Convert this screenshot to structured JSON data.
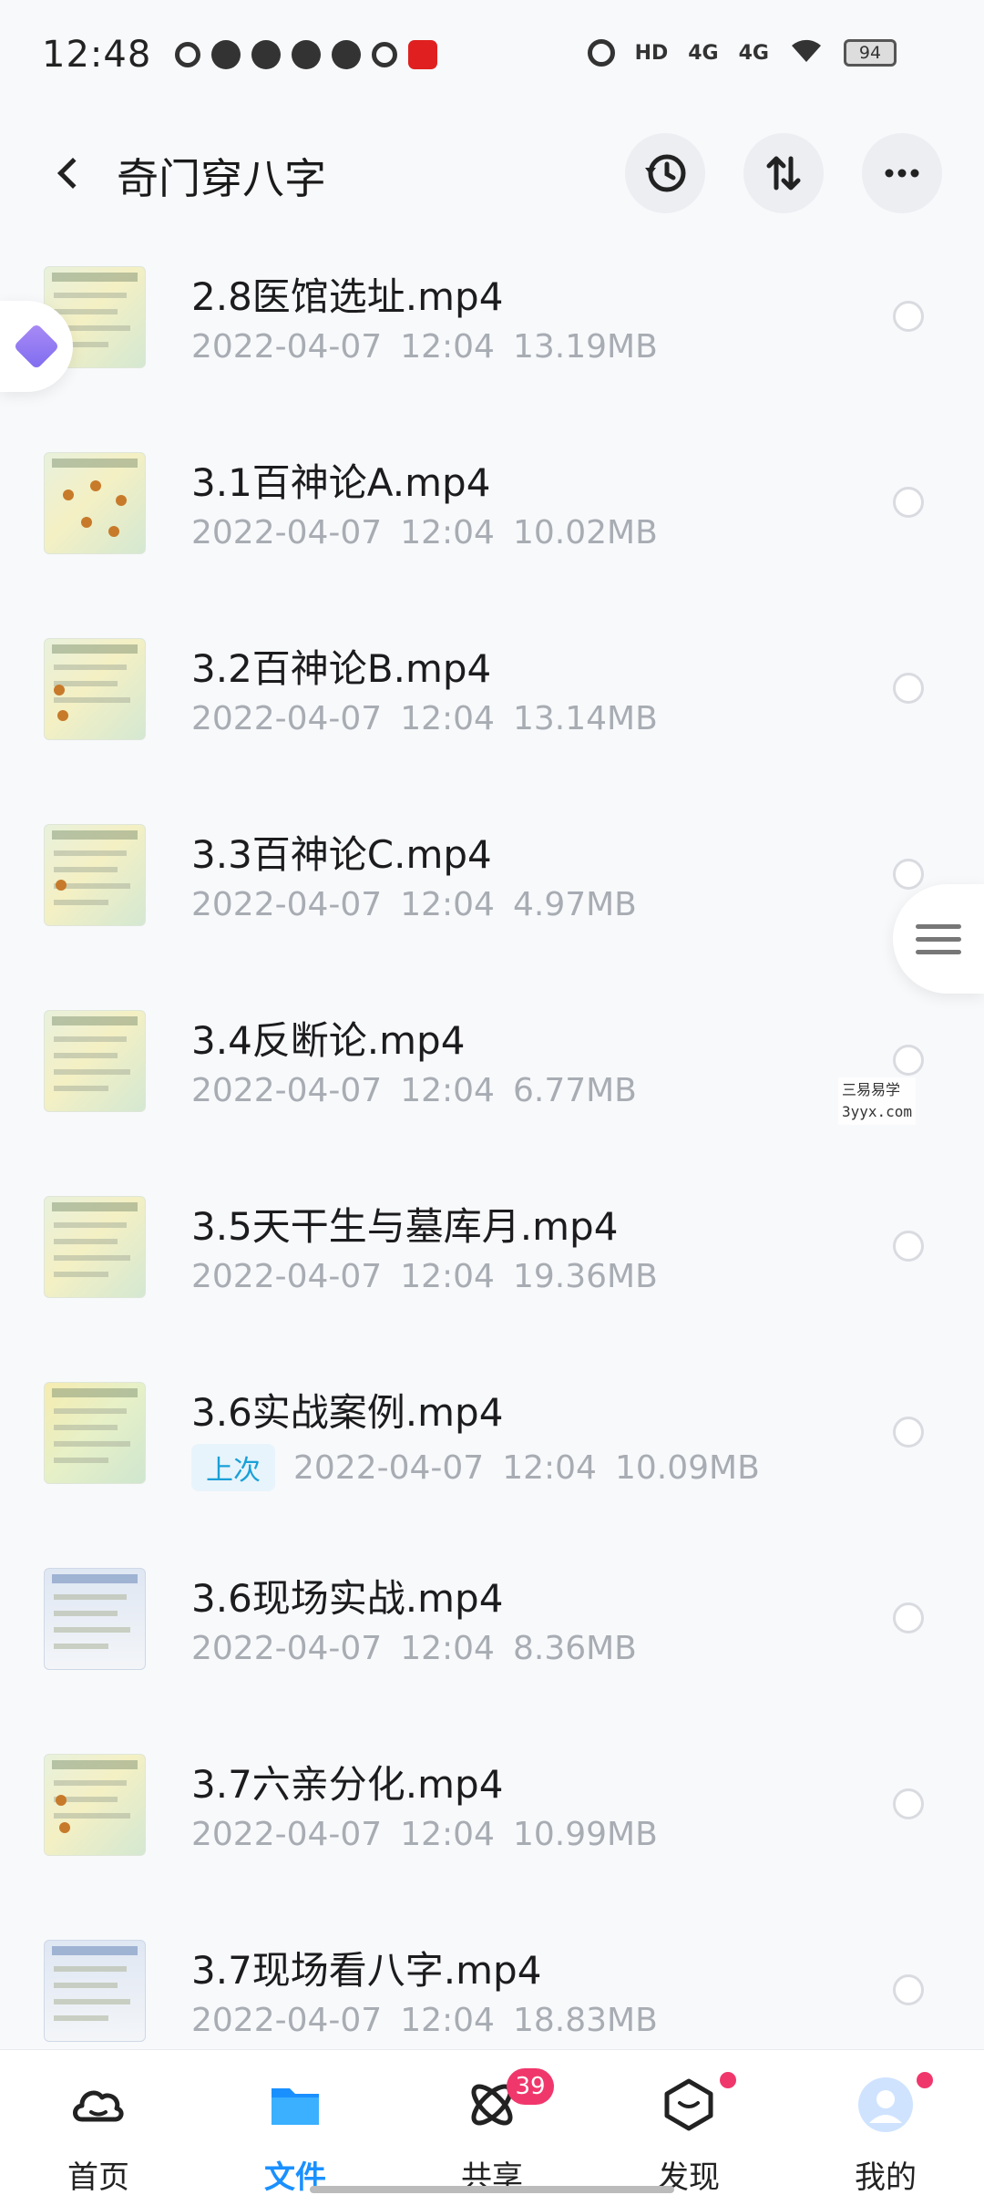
{
  "status_bar": {
    "time": "12:48",
    "right_labels": [
      "HD",
      "4G",
      "4G"
    ],
    "battery": "94"
  },
  "header": {
    "title": "奇门穿八字",
    "icons": [
      "back-icon",
      "history-icon",
      "sort-icon",
      "more-icon"
    ]
  },
  "files": [
    {
      "name": "2.8医馆选址.mp4",
      "date": "2022-04-07",
      "time": "12:04",
      "size": "13.19MB",
      "tag": ""
    },
    {
      "name": "3.1百神论A.mp4",
      "date": "2022-04-07",
      "time": "12:04",
      "size": "10.02MB",
      "tag": ""
    },
    {
      "name": "3.2百神论B.mp4",
      "date": "2022-04-07",
      "time": "12:04",
      "size": "13.14MB",
      "tag": ""
    },
    {
      "name": "3.3百神论C.mp4",
      "date": "2022-04-07",
      "time": "12:04",
      "size": "4.97MB",
      "tag": ""
    },
    {
      "name": "3.4反断论.mp4",
      "date": "2022-04-07",
      "time": "12:04",
      "size": "6.77MB",
      "tag": ""
    },
    {
      "name": "3.5天干生与墓库月.mp4",
      "date": "2022-04-07",
      "time": "12:04",
      "size": "19.36MB",
      "tag": ""
    },
    {
      "name": "3.6实战案例.mp4",
      "date": "2022-04-07",
      "time": "12:04",
      "size": "10.09MB",
      "tag": "上次"
    },
    {
      "name": "3.6现场实战.mp4",
      "date": "2022-04-07",
      "time": "12:04",
      "size": "8.36MB",
      "tag": ""
    },
    {
      "name": "3.7六亲分化.mp4",
      "date": "2022-04-07",
      "time": "12:04",
      "size": "10.99MB",
      "tag": ""
    },
    {
      "name": "3.7现场看八字.mp4",
      "date": "2022-04-07",
      "time": "12:04",
      "size": "18.83MB",
      "tag": ""
    }
  ],
  "watermark": {
    "line1": "三易易学",
    "line2": "3yyx.com"
  },
  "tabs": [
    {
      "label": "首页",
      "icon": "cloud-home-icon",
      "active": false,
      "badge": ""
    },
    {
      "label": "文件",
      "icon": "folder-icon",
      "active": true,
      "badge": ""
    },
    {
      "label": "共享",
      "icon": "share-atom-icon",
      "active": false,
      "badge": "39"
    },
    {
      "label": "发现",
      "icon": "discover-icon",
      "active": false,
      "badge": "dot"
    },
    {
      "label": "我的",
      "icon": "avatar-icon",
      "active": false,
      "badge": "dot"
    }
  ],
  "colors": {
    "accent": "#1a90ff",
    "badge": "#f0376b",
    "meta_text": "#a8acb3",
    "tag_bg": "#e8f4fb",
    "tag_text": "#1aa0d8"
  }
}
